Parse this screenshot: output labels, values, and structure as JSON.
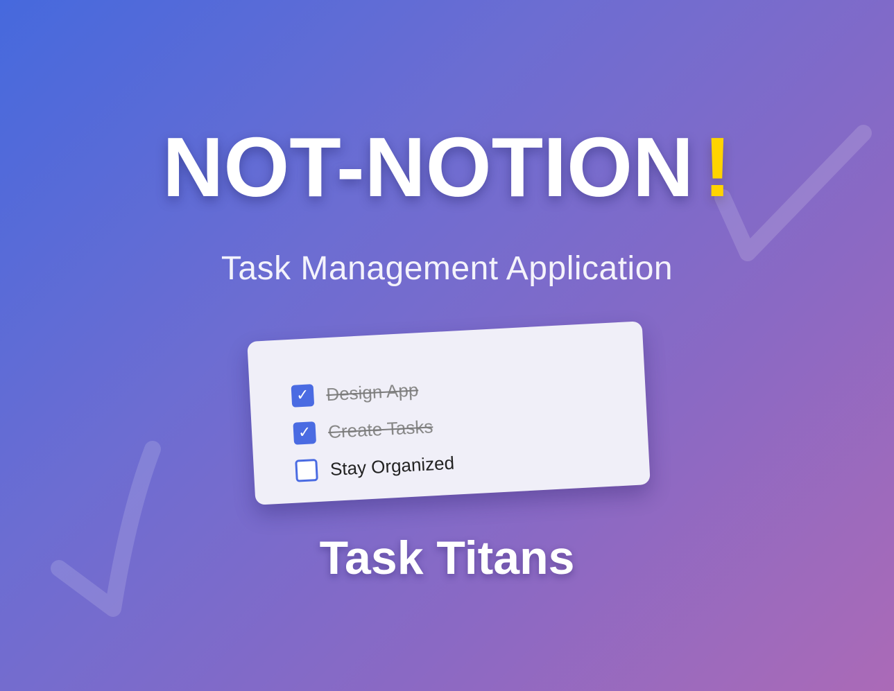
{
  "hero": {
    "title_main": "NOT-NOTION",
    "title_exclaim": "!",
    "subtitle": "Task Management Application"
  },
  "task_card": {
    "items": [
      {
        "label": "Design App",
        "checked": true,
        "check_glyph": "✓"
      },
      {
        "label": "Create Tasks",
        "checked": true,
        "check_glyph": "✓"
      },
      {
        "label": "Stay Organized",
        "checked": false,
        "check_glyph": ""
      }
    ]
  },
  "footer": {
    "team_name": "Task Titans"
  },
  "colors": {
    "gradient_start": "#4669dd",
    "gradient_end": "#ab6ab7",
    "accent_exclaim": "#ffd400",
    "checkbox_blue": "#4a6be2",
    "card_background": "#f0eff8"
  },
  "icons": {
    "background_left": "checkmark-icon",
    "background_right": "checkmark-icon",
    "checkbox_checked": "checkmark-icon"
  }
}
